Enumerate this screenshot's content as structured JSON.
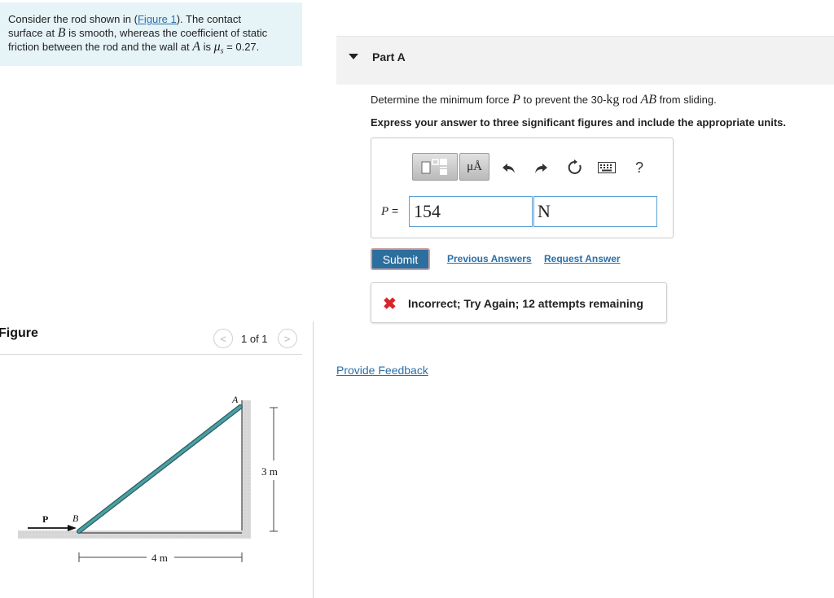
{
  "problem": {
    "line1_pre": "Consider the rod shown in (",
    "figure_link": "Figure 1",
    "line1_post": "). The contact",
    "line2_pre": "surface at ",
    "point_b": "B",
    "line2_post": " is smooth, whereas the coefficient of static",
    "line3_pre": "friction between the rod and the wall at ",
    "point_a": "A",
    "line3_mid": " is ",
    "mu_s": "μ",
    "mu_sub": "s",
    "line3_post": " = 0.27."
  },
  "figure": {
    "title": "Figure",
    "pager_prev": "<",
    "pager_text": "1 of 1",
    "pager_next": ">",
    "label_a": "A",
    "label_b": "B",
    "label_p": "P",
    "label_height": "3 m",
    "label_width": "4 m"
  },
  "part": {
    "title": "Part A",
    "question_pre": "Determine the minimum force ",
    "question_p": "P",
    "question_mid": " to prevent the 30-",
    "question_kg": "kg",
    "question_rod": " rod ",
    "question_ab": "AB",
    "question_post": " from sliding.",
    "instruction": "Express your answer to three significant figures and include the appropriate units."
  },
  "answer": {
    "units_tool_label": "μÅ",
    "help_label": "?",
    "p_label_var": "P",
    "p_label_eq": " =",
    "value": "154",
    "unit": "N"
  },
  "actions": {
    "submit": "Submit",
    "previous_answers": "Previous Answers",
    "request_answer": "Request Answer"
  },
  "feedback": {
    "icon": "✖",
    "message": "Incorrect; Try Again; 12 attempts remaining"
  },
  "footer": {
    "provide_feedback": "Provide Feedback"
  },
  "colors": {
    "problem_bg": "#e6f4f8",
    "link": "#2a6ea8",
    "submit": "#2c6e9e",
    "error": "#d7262b",
    "rod": "#3f8f94"
  }
}
